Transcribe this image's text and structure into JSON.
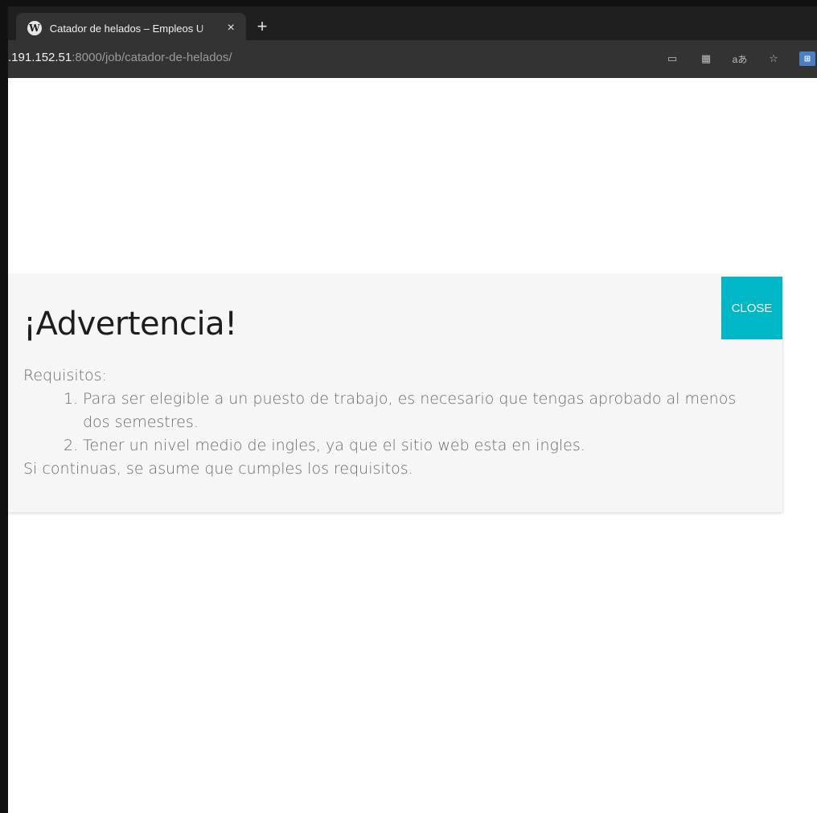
{
  "browser": {
    "tab_title": "Catador de helados – Empleos U",
    "tab_close": "×",
    "new_tab": "+",
    "favicon": "wordpress-icon",
    "url_host": ".191.152.51",
    "url_rest": ":8000/job/catador-de-helados/",
    "toolbar_icons": [
      "device-icon",
      "grid-icon",
      "translate-icon",
      "favorite-icon",
      "extension-icon"
    ]
  },
  "modal": {
    "title": "¡Advertencia!",
    "close_label": "CLOSE",
    "requirements_heading": "Requisitos:",
    "requirements": [
      {
        "num": "1.",
        "text": "Para ser elegible a un puesto de trabajo, es necesario que tengas aprobado al menos dos semestres."
      },
      {
        "num": "2.",
        "text": "Tener un nivel medio de ingles, ya que el sitio web esta en ingles."
      }
    ],
    "footer_text": "Si continuas, se asume que cumples los requisitos."
  },
  "colors": {
    "close_button": "#00b7c7",
    "modal_bg": "#f6f6f6",
    "chrome_dark": "#1f1f1f",
    "chrome_mid": "#333334"
  }
}
